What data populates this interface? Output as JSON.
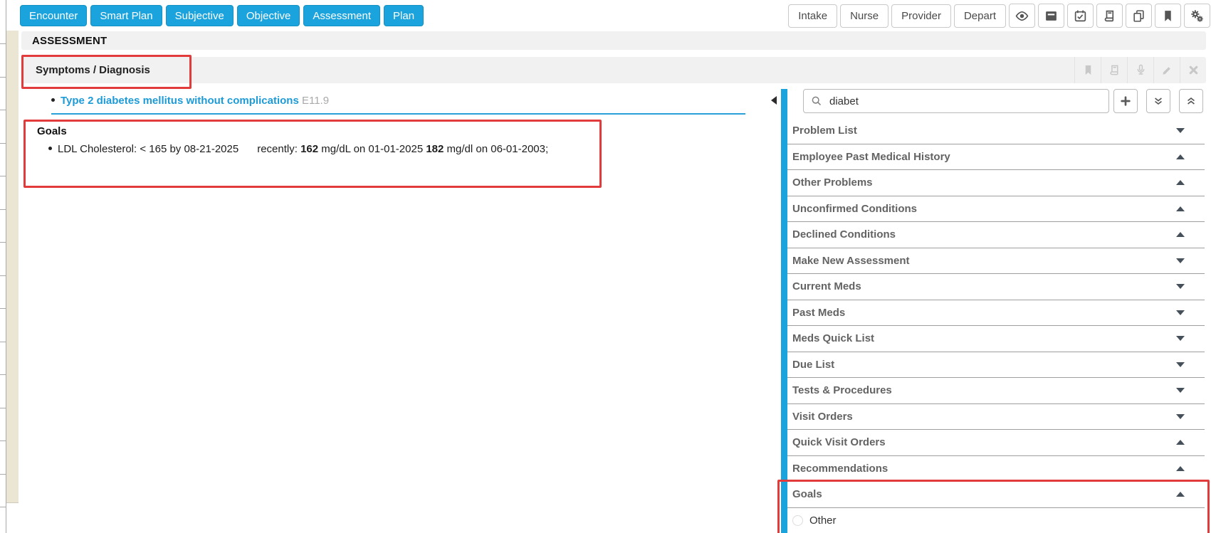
{
  "toolbar": {
    "nav_buttons": [
      "Encounter",
      "Smart Plan",
      "Subjective",
      "Objective",
      "Assessment",
      "Plan"
    ],
    "stage_buttons": [
      "Intake",
      "Nurse",
      "Provider",
      "Depart"
    ],
    "icon_buttons": [
      "eye-icon",
      "archive-box-icon",
      "calendar-check-icon",
      "book-icon",
      "copy-pages-icon",
      "bookmark-icon",
      "gear-settings-icon"
    ]
  },
  "page": {
    "section_title": "ASSESSMENT"
  },
  "symptoms_section": {
    "title": "Symptoms / Diagnosis",
    "header_icons": [
      "bookmark-icon",
      "book-icon",
      "microphone-icon",
      "pencil-icon",
      "close-icon"
    ],
    "diagnosis": {
      "name": "Type 2 diabetes mellitus without complications",
      "code": "E11.9"
    }
  },
  "goals_section": {
    "title": "Goals",
    "goal": {
      "text_before": "LDL Cholesterol: < 165 by 08-21-2025",
      "recent_label": "recently:",
      "value1": "162",
      "detail1": "mg/dL on 01-01-2025",
      "value2": "182",
      "detail2": "mg/dl on 06-01-2003;"
    }
  },
  "sidebar": {
    "search": {
      "value": "diabet"
    },
    "action_icons": [
      "plus-icon",
      "double-chevron-down-icon",
      "double-chevron-up-icon"
    ],
    "items": [
      {
        "label": "Problem List",
        "chevron": "down"
      },
      {
        "label": "Employee Past Medical History",
        "chevron": "up"
      },
      {
        "label": "Other Problems",
        "chevron": "up"
      },
      {
        "label": "Unconfirmed Conditions",
        "chevron": "up"
      },
      {
        "label": "Declined Conditions",
        "chevron": "up"
      },
      {
        "label": "Make New Assessment",
        "chevron": "down"
      },
      {
        "label": "Current Meds",
        "chevron": "down"
      },
      {
        "label": "Past Meds",
        "chevron": "down"
      },
      {
        "label": "Meds Quick List",
        "chevron": "down"
      },
      {
        "label": "Due List",
        "chevron": "down"
      },
      {
        "label": "Tests & Procedures",
        "chevron": "down"
      },
      {
        "label": "Visit Orders",
        "chevron": "down"
      },
      {
        "label": "Quick Visit Orders",
        "chevron": "up"
      },
      {
        "label": "Recommendations",
        "chevron": "up"
      },
      {
        "label": "Goals",
        "chevron": "up"
      }
    ],
    "goals_expanded_item": {
      "label": "Other"
    }
  },
  "colors": {
    "accent_blue": "#1aa3dc",
    "annotation_red": "#e23b3b",
    "section_bar_gray": "#f1f1f1",
    "diagnosis_link_blue": "#1d9bd7",
    "sidebar_text_gray": "#636363"
  }
}
